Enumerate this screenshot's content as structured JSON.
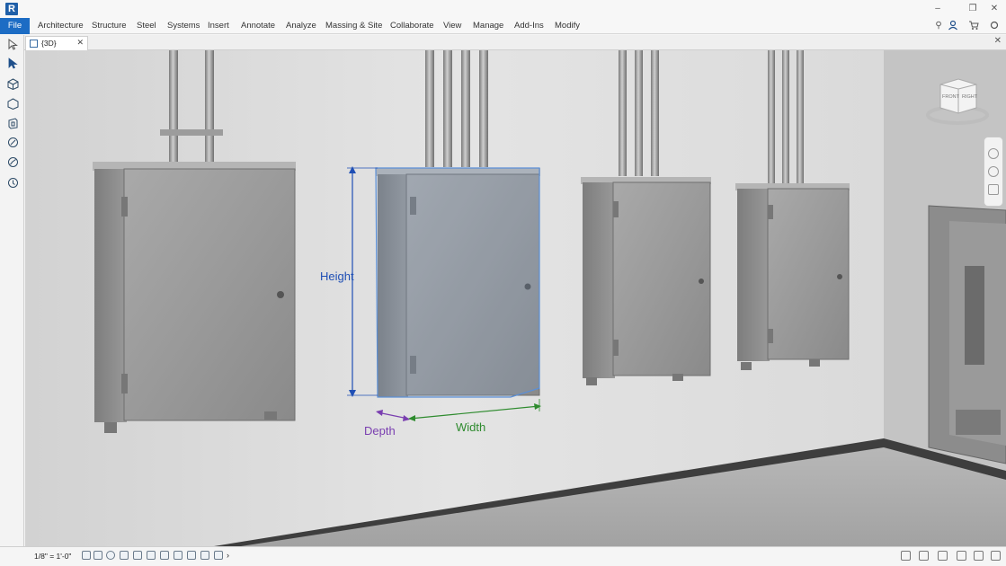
{
  "app": {
    "logo_letter": "R",
    "accent_color": "#1c6cc4",
    "icons": [
      "minimize-icon",
      "restore-icon",
      "close-icon"
    ]
  },
  "ribbon": {
    "file_label": "File",
    "tabs": [
      "Architecture",
      "Structure",
      "Steel",
      "Systems",
      "Insert",
      "Annotate",
      "Analyze",
      "Massing & Site",
      "Collaborate",
      "View",
      "Manage",
      "Add-Ins",
      "Modify"
    ],
    "right_icons": [
      "pin-icon",
      "user-icon",
      "cart-icon",
      "settings-icon"
    ]
  },
  "view_tab": {
    "label": "{3D}",
    "close": "✕"
  },
  "tools": {
    "left": [
      "select-arrow-icon",
      "modify-icon",
      "3d-box-icon",
      "section-box-icon",
      "wall-icon",
      "component-icon",
      "annotation-icon",
      "clock-icon"
    ]
  },
  "annotations": {
    "height": {
      "label": "Height",
      "color": "#1f4fb5"
    },
    "depth": {
      "label": "Depth",
      "color": "#7a3fb0"
    },
    "width": {
      "label": "Width",
      "color": "#2e8b2e"
    }
  },
  "viewcube": {
    "front_label": "FRONT",
    "right_label": "RIGHT"
  },
  "statusbar": {
    "scale": "1/8\" = 1'-0\""
  }
}
